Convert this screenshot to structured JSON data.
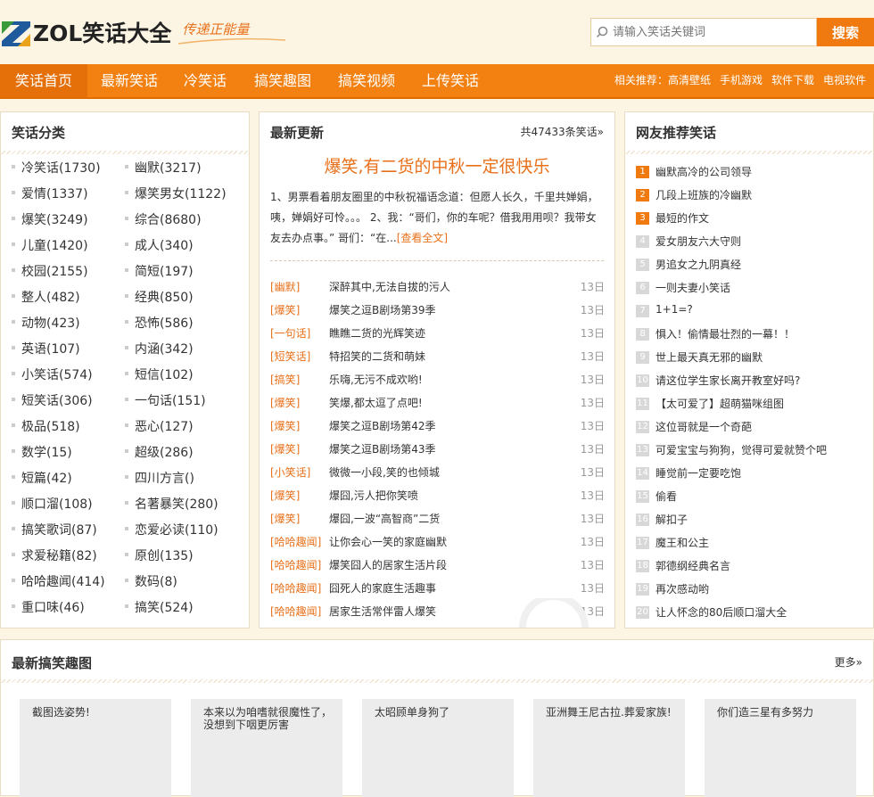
{
  "brand": {
    "logo_text": "ZOL笑话大全",
    "slogan": "传递正能量",
    "accent_color": "#f07a10"
  },
  "search": {
    "placeholder": "请输入笑话关键词",
    "button_label": "搜索",
    "icon": "search-icon"
  },
  "nav": {
    "items": [
      {
        "label": "笑话首页",
        "active": true
      },
      {
        "label": "最新笑话"
      },
      {
        "label": "冷笑话"
      },
      {
        "label": "搞笑趣图"
      },
      {
        "label": "搞笑视频"
      },
      {
        "label": "上传笑话"
      }
    ],
    "related_label": "相关推荐：",
    "related": [
      "高清壁纸",
      "手机游戏",
      "软件下载",
      "电视软件"
    ]
  },
  "categories": {
    "title": "笑话分类",
    "items": [
      "冷笑话(1730)",
      "幽默(3217)",
      "爱情(1337)",
      "爆笑男女(1122)",
      "爆笑(3249)",
      "综合(8680)",
      "儿童(1420)",
      "成人(340)",
      "校园(2155)",
      "简短(197)",
      "整人(482)",
      "经典(850)",
      "动物(423)",
      "恐怖(586)",
      "英语(107)",
      "内涵(342)",
      "小笑话(574)",
      "短信(102)",
      "短笑话(306)",
      "一句话(151)",
      "极品(518)",
      "恶心(127)",
      "数学(15)",
      "超级(286)",
      "短篇(42)",
      "四川方言()",
      "顺口溜(108)",
      "名著暴笑(280)",
      "搞笑歌词(87)",
      "恋爱必读(110)",
      "求爱秘籍(82)",
      "原创(135)",
      "哈哈趣闻(414)",
      "数码(8)",
      "重口味(46)",
      "搞笑(524)"
    ]
  },
  "latest": {
    "title": "最新更新",
    "count_text": "共47433条笑话»",
    "headline": "爆笑,有二货的中秋一定很快乐",
    "excerpt": "1、男票看着朋友圈里的中秋祝福语念道：但愿人长久，千里共婵娟，咦，婵娟好可怜。。。 2、我：“哥们，你的车呢？借我用用呗？我带女友去办点事。” 哥们：“在...",
    "read_more": "[查看全文]",
    "rows": [
      {
        "tag": "[幽默]",
        "title": "深醉其中,无法自拔的污人",
        "date": "13日"
      },
      {
        "tag": "[爆笑]",
        "title": "爆笑之逗B剧场第39季",
        "date": "13日"
      },
      {
        "tag": "[一句话]",
        "title": "瞧瞧二货的光辉笑迹",
        "date": "13日"
      },
      {
        "tag": "[短笑话]",
        "title": "特招笑的二货和萌妹",
        "date": "13日"
      },
      {
        "tag": "[搞笑]",
        "title": "乐嗨,无污不成欢哟!",
        "date": "13日"
      },
      {
        "tag": "[爆笑]",
        "title": "笑爆,都太逗了点吧!",
        "date": "13日"
      },
      {
        "tag": "[爆笑]",
        "title": "爆笑之逗B剧场第42季",
        "date": "13日"
      },
      {
        "tag": "[爆笑]",
        "title": "爆笑之逗B剧场第43季",
        "date": "13日"
      },
      {
        "tag": "[小笑话]",
        "title": "微微一小段,笑的也倾城",
        "date": "13日"
      },
      {
        "tag": "[爆笑]",
        "title": "爆囧,污人把你笑喷",
        "date": "13日"
      },
      {
        "tag": "[爆笑]",
        "title": "爆囧,一波“高智商”二货",
        "date": "13日"
      },
      {
        "tag": "[哈哈趣闻]",
        "title": "让你会心一笑的家庭幽默",
        "date": "13日"
      },
      {
        "tag": "[哈哈趣闻]",
        "title": "爆笑囧人的居家生活片段",
        "date": "13日"
      },
      {
        "tag": "[哈哈趣闻]",
        "title": "囧死人的家庭生活趣事",
        "date": "13日"
      },
      {
        "tag": "[哈哈趣闻]",
        "title": "居家生活常伴雷人爆笑",
        "date": "13日"
      }
    ]
  },
  "recommend": {
    "title": "网友推荐笑话",
    "items": [
      "幽默高冷的公司领导",
      "几段上班族的冷幽默",
      "最短的作文",
      "爱女朋友六大守则",
      "男追女之九阴真经",
      "一则夫妻小笑话",
      "1+1=?",
      "惧入！偷情最壮烈的一幕！！",
      "世上最天真无邪的幽默",
      "请这位学生家长离开教室好吗?",
      "【太可爱了】超萌猫咪组图",
      "这位哥就是一个奇葩",
      "可爱宝宝与狗狗，觉得可爱就赞个吧",
      "睡觉前一定要吃饱",
      "偷看",
      "解扣子",
      "魔王和公主",
      "郭德纲经典名言",
      "再次感动哟",
      "让人怀念的80后顺口溜大全"
    ]
  },
  "pictures": {
    "title": "最新搞笑趣图",
    "more": "更多»",
    "items": [
      "截图选姿势!",
      "本来以为咱嗜就很魔性了，没想到下咽更厉害",
      "太昭顾单身狗了",
      "亚洲舞王尼古拉.葬爱家族!",
      "你们造三星有多努力"
    ]
  }
}
